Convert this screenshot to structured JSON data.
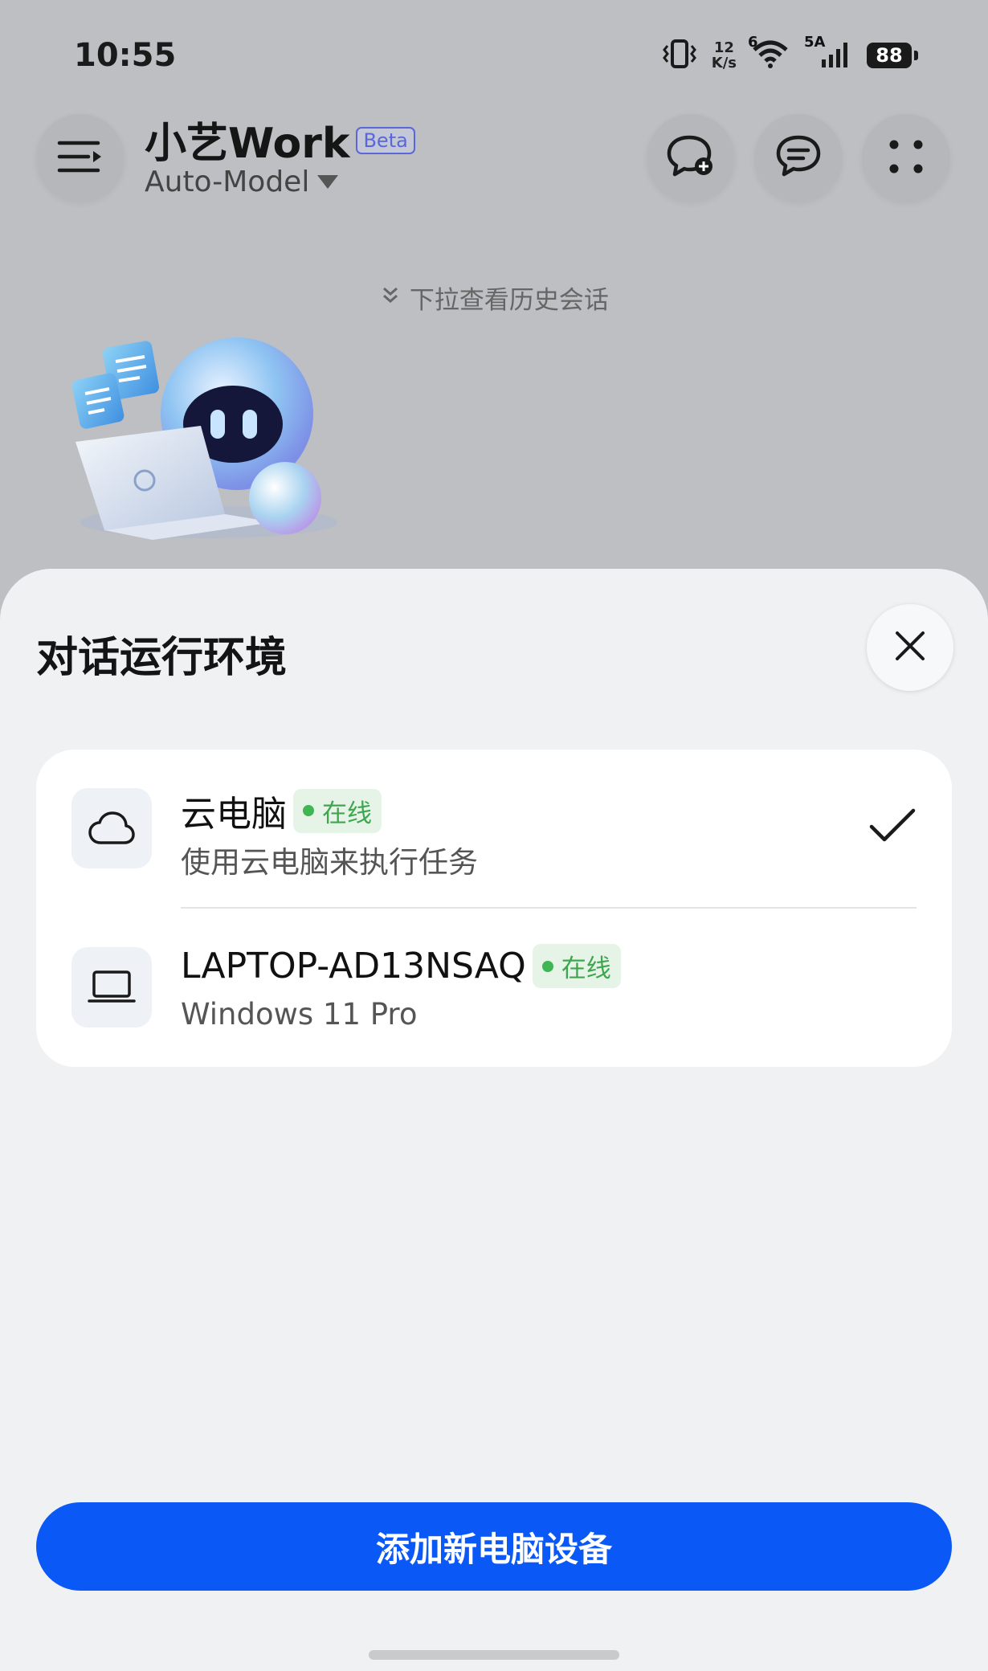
{
  "status_bar": {
    "time": "10:55",
    "net_speed_value": "12",
    "net_speed_unit": "K/s",
    "wifi_label": "6",
    "cell_label": "5A",
    "battery": "88"
  },
  "header": {
    "title": "小艺Work",
    "badge": "Beta",
    "model": "Auto-Model"
  },
  "pull_hint": "下拉查看历史会话",
  "sheet": {
    "title": "对话运行环境",
    "environments": [
      {
        "name": "云电脑",
        "status": "在线",
        "description": "使用云电脑来执行任务",
        "icon": "cloud-icon",
        "selected": true
      },
      {
        "name": "LAPTOP-AD13NSAQ",
        "status": "在线",
        "description": "Windows 11 Pro",
        "icon": "laptop-icon",
        "selected": false
      }
    ],
    "add_button": "添加新电脑设备"
  },
  "colors": {
    "accent": "#0a59f7",
    "online": "#3fb554",
    "badge": "#5a67d8"
  }
}
